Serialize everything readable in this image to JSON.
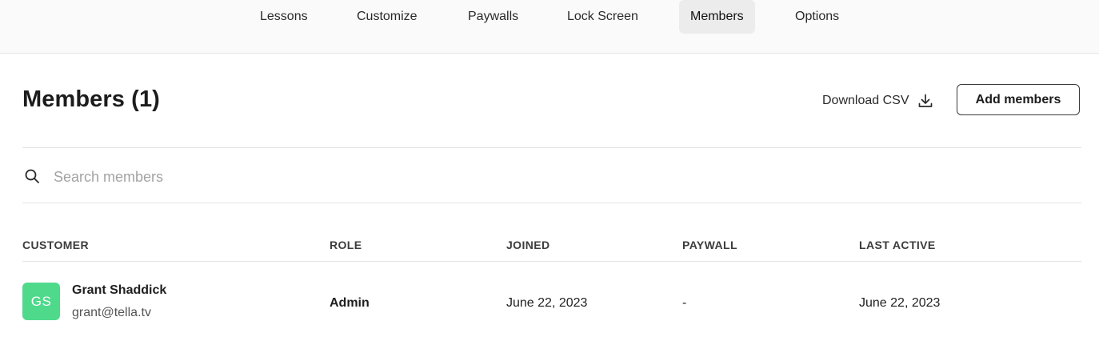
{
  "nav": {
    "tabs": [
      {
        "label": "Lessons"
      },
      {
        "label": "Customize"
      },
      {
        "label": "Paywalls"
      },
      {
        "label": "Lock Screen"
      },
      {
        "label": "Members"
      },
      {
        "label": "Options"
      }
    ],
    "active": "Members"
  },
  "header": {
    "title": "Members (1)",
    "download_label": "Download CSV",
    "download_icon": "download-icon",
    "add_label": "Add members"
  },
  "search": {
    "placeholder": "Search members",
    "icon": "search-icon",
    "value": ""
  },
  "table": {
    "columns": [
      "CUSTOMER",
      "ROLE",
      "JOINED",
      "PAYWALL",
      "LAST ACTIVE"
    ],
    "rows": [
      {
        "initials": "GS",
        "name": "Grant Shaddick",
        "email": "grant@tella.tv",
        "role": "Admin",
        "joined": "June 22, 2023",
        "paywall": "-",
        "last_active": "June 22, 2023"
      }
    ]
  },
  "colors": {
    "avatar": "#4fd98b",
    "active_tab_bg": "#ececec"
  }
}
